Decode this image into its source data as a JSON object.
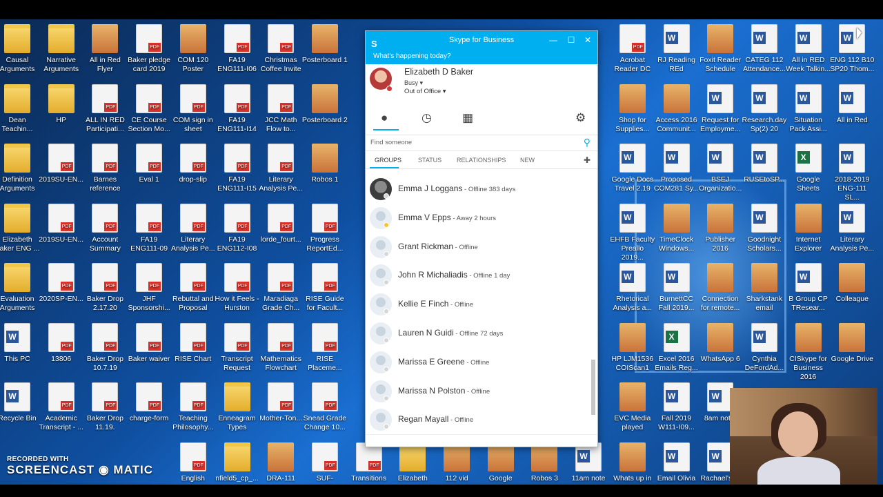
{
  "desktop_icons": [
    {
      "label": "Causal Arguments",
      "type": "folder",
      "x": 0,
      "y": 0
    },
    {
      "label": "Narrative Arguments",
      "type": "folder",
      "x": 1,
      "y": 0
    },
    {
      "label": "All in Red Flyer",
      "type": "pic",
      "x": 2,
      "y": 0
    },
    {
      "label": "Baker pledge card 2019",
      "type": "pdf",
      "x": 3,
      "y": 0
    },
    {
      "label": "COM 120 Poster",
      "type": "pic",
      "x": 4,
      "y": 0
    },
    {
      "label": "FA19 ENG111-I06",
      "type": "pdf",
      "x": 5,
      "y": 0
    },
    {
      "label": "Christmas Coffee Invite",
      "type": "pdf",
      "x": 6,
      "y": 0
    },
    {
      "label": "Posterboard 1",
      "type": "pic",
      "x": 7,
      "y": 0
    },
    {
      "label": "Dean Teachin...",
      "type": "folder",
      "x": 0,
      "y": 1
    },
    {
      "label": "HP",
      "type": "folder",
      "x": 1,
      "y": 1
    },
    {
      "label": "ALL IN RED Participati...",
      "type": "pdf",
      "x": 2,
      "y": 1
    },
    {
      "label": "CE Course Section Mo...",
      "type": "pdf",
      "x": 3,
      "y": 1
    },
    {
      "label": "COM sign in sheet",
      "type": "pdf",
      "x": 4,
      "y": 1
    },
    {
      "label": "FA19 ENG111-I14",
      "type": "pdf",
      "x": 5,
      "y": 1
    },
    {
      "label": "JCC Math Flow to...",
      "type": "pdf",
      "x": 6,
      "y": 1
    },
    {
      "label": "Posterboard 2",
      "type": "pic",
      "x": 7,
      "y": 1
    },
    {
      "label": "Definition Arguments",
      "type": "folder",
      "x": 0,
      "y": 2
    },
    {
      "label": "2019SU-EN...",
      "type": "pdf",
      "x": 1,
      "y": 2
    },
    {
      "label": "Barnes reference",
      "type": "pdf",
      "x": 2,
      "y": 2
    },
    {
      "label": "Eval 1",
      "type": "pdf",
      "x": 3,
      "y": 2
    },
    {
      "label": "drop-slip",
      "type": "pdf",
      "x": 4,
      "y": 2
    },
    {
      "label": "FA19 ENG111-I15",
      "type": "pdf",
      "x": 5,
      "y": 2
    },
    {
      "label": "Literary Analysis Pe...",
      "type": "pdf",
      "x": 6,
      "y": 2
    },
    {
      "label": "Robos 1",
      "type": "pic",
      "x": 7,
      "y": 2
    },
    {
      "label": "Elizabeth Baker ENG ...",
      "type": "folder",
      "x": 0,
      "y": 3
    },
    {
      "label": "2019SU-EN...",
      "type": "pdf",
      "x": 1,
      "y": 3
    },
    {
      "label": "Account Summary",
      "type": "pdf",
      "x": 2,
      "y": 3
    },
    {
      "label": "FA19 ENG111-09",
      "type": "pdf",
      "x": 3,
      "y": 3
    },
    {
      "label": "Literary Analysis Pe...",
      "type": "pdf",
      "x": 4,
      "y": 3
    },
    {
      "label": "FA19 ENG112-I08",
      "type": "pdf",
      "x": 5,
      "y": 3
    },
    {
      "label": "lorde_fourt...",
      "type": "pdf",
      "x": 6,
      "y": 3
    },
    {
      "label": "Progress ReportEd...",
      "type": "pdf",
      "x": 7,
      "y": 3
    },
    {
      "label": "Evaluation Arguments",
      "type": "folder",
      "x": 0,
      "y": 4
    },
    {
      "label": "2020SP-EN...",
      "type": "pdf",
      "x": 1,
      "y": 4
    },
    {
      "label": "Baker Drop 2.17.20",
      "type": "pdf",
      "x": 2,
      "y": 4
    },
    {
      "label": "JHF Sponsorshi...",
      "type": "pdf",
      "x": 3,
      "y": 4
    },
    {
      "label": "Rebuttal and Proposal",
      "type": "pdf",
      "x": 4,
      "y": 4
    },
    {
      "label": "How it Feels - Hurston",
      "type": "pdf",
      "x": 5,
      "y": 4
    },
    {
      "label": "Maradiaga Grade Ch...",
      "type": "pdf",
      "x": 6,
      "y": 4
    },
    {
      "label": "RISE Guide for Facult...",
      "type": "pdf",
      "x": 7,
      "y": 4
    },
    {
      "label": "This PC",
      "type": "doc",
      "x": 0,
      "y": 5
    },
    {
      "label": "13806",
      "type": "pdf",
      "x": 1,
      "y": 5
    },
    {
      "label": "Baker Drop 10.7.19",
      "type": "pdf",
      "x": 2,
      "y": 5
    },
    {
      "label": "Baker waiver",
      "type": "pdf",
      "x": 3,
      "y": 5
    },
    {
      "label": "RISE Chart",
      "type": "pdf",
      "x": 4,
      "y": 5
    },
    {
      "label": "Transcript Request",
      "type": "pdf",
      "x": 5,
      "y": 5
    },
    {
      "label": "Mathematics Flowchart",
      "type": "pdf",
      "x": 6,
      "y": 5
    },
    {
      "label": "RISE Placeme...",
      "type": "pdf",
      "x": 7,
      "y": 5
    },
    {
      "label": "Recycle Bin",
      "type": "doc",
      "x": 0,
      "y": 6
    },
    {
      "label": "Academic Transcript - ...",
      "type": "pdf",
      "x": 1,
      "y": 6
    },
    {
      "label": "Baker Drop 11.19.",
      "type": "pdf",
      "x": 2,
      "y": 6
    },
    {
      "label": "charge-form",
      "type": "pdf",
      "x": 3,
      "y": 6
    },
    {
      "label": "Teaching Philosophy...",
      "type": "pdf",
      "x": 4,
      "y": 6
    },
    {
      "label": "Enneagram Types",
      "type": "folder",
      "x": 5,
      "y": 6
    },
    {
      "label": "Mother-Ton...",
      "type": "pdf",
      "x": 6,
      "y": 6
    },
    {
      "label": "Snead Grade Change 10...",
      "type": "pdf",
      "x": 7,
      "y": 6
    },
    {
      "label": "English",
      "type": "pdf",
      "x": 4,
      "y": 7
    },
    {
      "label": "nfield5_cp_...",
      "type": "folder",
      "x": 5,
      "y": 7
    },
    {
      "label": "DRA-111",
      "type": "pic",
      "x": 6,
      "y": 7
    },
    {
      "label": "SUF-BAKER-...",
      "type": "pdf",
      "x": 7,
      "y": 7
    },
    {
      "label": "Transitions",
      "type": "pdf",
      "x": 8,
      "y": 7
    },
    {
      "label": "Elizabeth",
      "type": "folder",
      "x": 9,
      "y": 7
    },
    {
      "label": "112 vid",
      "type": "pic",
      "x": 10,
      "y": 7
    },
    {
      "label": "Google",
      "type": "pic",
      "x": 11,
      "y": 7
    },
    {
      "label": "Robos 3",
      "type": "pic",
      "x": 12,
      "y": 7
    },
    {
      "label": "11am note",
      "type": "doc",
      "x": 13,
      "y": 7
    },
    {
      "label": "Whats up in",
      "type": "pic",
      "x": 14,
      "y": 7
    },
    {
      "label": "Email Olivia",
      "type": "doc",
      "x": 15,
      "y": 7
    },
    {
      "label": "Rachael's ...",
      "type": "doc",
      "x": 16,
      "y": 7
    },
    {
      "label": "Acrobat Reader DC",
      "type": "pdf",
      "x": 14,
      "y": 0
    },
    {
      "label": "RJ Reading REd",
      "type": "doc",
      "x": 15,
      "y": 0
    },
    {
      "label": "Foxit Reader Schedule",
      "type": "pic",
      "x": 16,
      "y": 0
    },
    {
      "label": "CATEG 112 Attendance...",
      "type": "doc",
      "x": 17,
      "y": 0
    },
    {
      "label": "All in RED Week Talkin...",
      "type": "doc",
      "x": 18,
      "y": 0
    },
    {
      "label": "ENG 112 B10 SP20 Thom...",
      "type": "doc",
      "x": 19,
      "y": 0
    },
    {
      "label": "Shop for Supplies...",
      "type": "pic",
      "x": 14,
      "y": 1
    },
    {
      "label": "Access 2016 Communit...",
      "type": "pic",
      "x": 15,
      "y": 1
    },
    {
      "label": "Request for Employme...",
      "type": "doc",
      "x": 16,
      "y": 1
    },
    {
      "label": "Research.day Sp(2) 20",
      "type": "doc",
      "x": 17,
      "y": 1
    },
    {
      "label": "Situation Pack Assi...",
      "type": "doc",
      "x": 18,
      "y": 1
    },
    {
      "label": "All in Red",
      "type": "doc",
      "x": 19,
      "y": 1
    },
    {
      "label": "Google Docs Travel 2.19",
      "type": "doc",
      "x": 14,
      "y": 2
    },
    {
      "label": "Proposed COM281 Sy...",
      "type": "doc",
      "x": 15,
      "y": 2
    },
    {
      "label": "BSEJ Organizatio...",
      "type": "doc",
      "x": 16,
      "y": 2
    },
    {
      "label": "RUSEtoSP...",
      "type": "doc",
      "x": 17,
      "y": 2
    },
    {
      "label": "Google Sheets",
      "type": "xls",
      "x": 18,
      "y": 2
    },
    {
      "label": "2018-2019 ENG-111 SL...",
      "type": "doc",
      "x": 19,
      "y": 2
    },
    {
      "label": "EHFB Faculty Preallo 2019...",
      "type": "doc",
      "x": 14,
      "y": 3
    },
    {
      "label": "TimeClock Windows...",
      "type": "pic",
      "x": 15,
      "y": 3
    },
    {
      "label": "Publisher 2016",
      "type": "pic",
      "x": 16,
      "y": 3
    },
    {
      "label": "Goodnight Scholars...",
      "type": "doc",
      "x": 17,
      "y": 3
    },
    {
      "label": "Internet Explorer",
      "type": "pic",
      "x": 18,
      "y": 3
    },
    {
      "label": "Literary Analysis Pe...",
      "type": "doc",
      "x": 19,
      "y": 3
    },
    {
      "label": "Rhetorical Analysis a...",
      "type": "doc",
      "x": 14,
      "y": 4
    },
    {
      "label": "BurnettCC Fall 2019...",
      "type": "doc",
      "x": 15,
      "y": 4
    },
    {
      "label": "Connection for remote...",
      "type": "pic",
      "x": 16,
      "y": 4
    },
    {
      "label": "Sharkstank email",
      "type": "pic",
      "x": 17,
      "y": 4
    },
    {
      "label": "B Group CP TResear...",
      "type": "doc",
      "x": 18,
      "y": 4
    },
    {
      "label": "Colleague",
      "type": "pic",
      "x": 19,
      "y": 4
    },
    {
      "label": "HP LJM1536 COIScan1",
      "type": "pic",
      "x": 14,
      "y": 5
    },
    {
      "label": "Excel 2016 Emails Reg...",
      "type": "xls",
      "x": 15,
      "y": 5
    },
    {
      "label": "WhatsApp 6",
      "type": "pic",
      "x": 16,
      "y": 5
    },
    {
      "label": "Cynthia DeFordAd...",
      "type": "doc",
      "x": 17,
      "y": 5
    },
    {
      "label": "CISkype for Business 2016",
      "type": "pic",
      "x": 18,
      "y": 5
    },
    {
      "label": "Google Drive",
      "type": "pic",
      "x": 19,
      "y": 5
    },
    {
      "label": "EVC Media played",
      "type": "pic",
      "x": 14,
      "y": 6
    },
    {
      "label": "Fall 2019 W111-I09...",
      "type": "doc",
      "x": 15,
      "y": 6
    },
    {
      "label": "8am not...",
      "type": "doc",
      "x": 16,
      "y": 6
    }
  ],
  "skype": {
    "title": "Skype for Business",
    "logo": "S",
    "minimize": "—",
    "maximize": "☐",
    "close": "✕",
    "whats_happening": "What's happening today?",
    "user_name": "Elizabeth D Baker",
    "status": "Busy ▾",
    "location": "Out of Office ▾",
    "search_placeholder": "Find someone",
    "tabs": [
      "GROUPS",
      "STATUS",
      "RELATIONSHIPS",
      "NEW"
    ],
    "contacts": [
      {
        "name": "Emma J Loggans",
        "status": " - Offline 383 days",
        "presence": "offline",
        "photo": true
      },
      {
        "name": "Emma V Epps",
        "status": " - Away 2 hours",
        "presence": "away",
        "photo": false
      },
      {
        "name": "Grant  Rickman",
        "status": " - Offline",
        "presence": "offline",
        "photo": false
      },
      {
        "name": "John R Michaliadis",
        "status": " - Offline 1 day",
        "presence": "offline",
        "photo": false
      },
      {
        "name": "Kellie E Finch",
        "status": " - Offline",
        "presence": "offline",
        "photo": false
      },
      {
        "name": "Lauren N Guidi",
        "status": " - Offline 72 days",
        "presence": "offline",
        "photo": false
      },
      {
        "name": "Marissa E Greene",
        "status": " - Offline",
        "presence": "offline",
        "photo": false
      },
      {
        "name": "Marissa N Polston",
        "status": " - Offline",
        "presence": "offline",
        "photo": false
      },
      {
        "name": "Regan  Mayall",
        "status": " - Offline",
        "presence": "offline",
        "photo": false
      }
    ]
  },
  "watermark": {
    "line1": "RECORDED WITH",
    "line2": "SCREENCAST ◉ MATIC"
  },
  "colors": {
    "skype_blue": "#00aff0",
    "busy_red": "#d13a3a",
    "away_yellow": "#f8c42a"
  }
}
